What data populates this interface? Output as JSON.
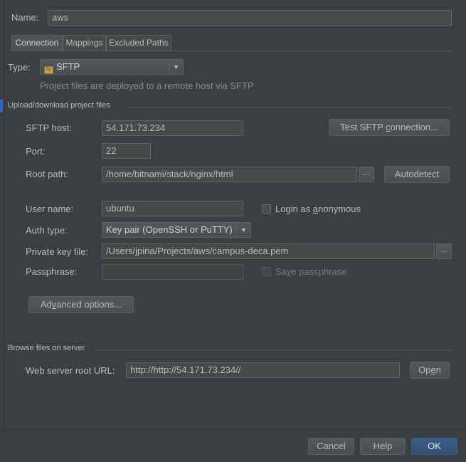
{
  "name": {
    "label": "Name:",
    "value": "aws"
  },
  "tabs": [
    {
      "label": "Connection"
    },
    {
      "label": "Mappings"
    },
    {
      "label": "Excluded Paths"
    }
  ],
  "type": {
    "label": "Type:",
    "icon": "sftp-server-icon",
    "value": "SFTP",
    "hint": "Project files are deployed to a remote host via SFTP"
  },
  "upload_section": {
    "title": "Upload/download project files"
  },
  "sftp_host": {
    "label": "SFTP host:",
    "value": "54.171.73.234",
    "test_button_pre": "Test SFTP ",
    "test_button_u": "c",
    "test_button_post": "onnection..."
  },
  "port": {
    "label": "Port:",
    "value": "22"
  },
  "root_path": {
    "label": "Root path:",
    "value": "/home/bitnami/stack/nginx/html",
    "browse": "...",
    "autodetect": "Autodetect"
  },
  "user_name": {
    "label": "User name:",
    "value": "ubuntu",
    "anon_pre": "Login as ",
    "anon_u": "a",
    "anon_post": "nonymous"
  },
  "auth_type": {
    "label": "Auth type:",
    "value": "Key pair (OpenSSH or PuTTY)"
  },
  "private_key": {
    "label": "Private key file:",
    "value": "/Users/jpina/Projects/aws/campus-deca.pem",
    "browse": "..."
  },
  "passphrase": {
    "label": "Passphrase:",
    "value": "",
    "save_pre": "Sa",
    "save_u": "v",
    "save_post": "e passphrase"
  },
  "advanced": {
    "pre": "Ad",
    "u": "v",
    "post": "anced options..."
  },
  "browse_section": {
    "title": "Browse files on server"
  },
  "web_root": {
    "label": "Web server root URL:",
    "value": "http://http://54.171.73.234//",
    "open_pre": "Op",
    "open_u": "e",
    "open_post": "n"
  },
  "footer": {
    "cancel": "Cancel",
    "help": "Help",
    "ok": "OK"
  },
  "colors": {
    "background": "#3c3f41",
    "accent": "#365880",
    "text": "#bbbbbb"
  }
}
